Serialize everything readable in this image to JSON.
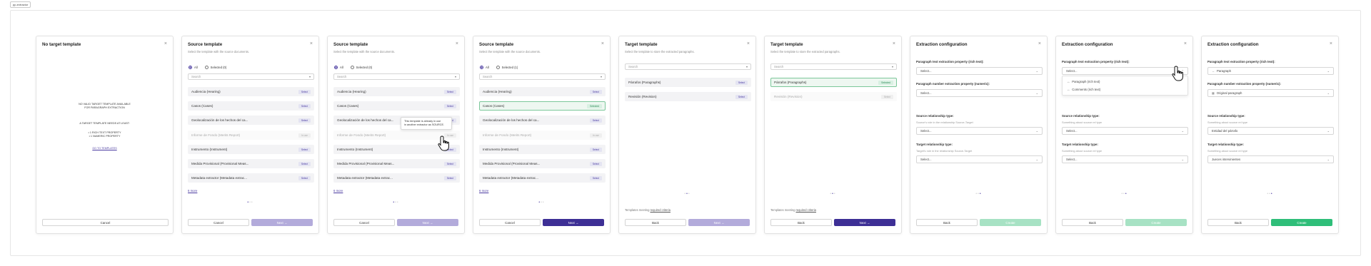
{
  "frame_label": "pp-extractor",
  "colors": {
    "primary": "#3d2f95",
    "primary_disabled": "#b3abdb",
    "success": "#2fbe79",
    "success_disabled": "#a7e2c4",
    "selected_border": "#7cc79a"
  },
  "panel1": {
    "title": "No target template",
    "message_line1": "NO VALID TARGET TEMPLATE AVAILABLE",
    "message_line2": "FOR PARAGRAPH EXTRACTION",
    "requirement_intro": "A TARGET TEMPLATE NEEDS AT LEAST:",
    "requirement_1": "• 1 RICH TEXT PROPERTY",
    "requirement_2": "• 1 NUMERIC PROPERTY",
    "link": "GO TO TEMPLATES",
    "cancel": "Cancel"
  },
  "source": {
    "title": "Source template",
    "subtitle": "Select the template with the source documents.",
    "radio_all": "All",
    "search_placeholder": "Search",
    "select_label": "Select",
    "selected_label": "Selected",
    "ghost_label": "In use",
    "items": [
      "Audiencia (Hearing)",
      "Casos (Cases)",
      "Geolocalización de los hechos del ca...",
      "Informe de Fondo (Merits Report)",
      "Instrumento (Instrument)",
      "Medida Provisional (Provisional Meas...",
      "Metadata extractor (Metadata extrac..."
    ],
    "more": "6 more",
    "cancel": "Cancel",
    "next": "Next",
    "tooltip_line1": "This template is already in use",
    "tooltip_line2": "in another extractor as SOURCE."
  },
  "panel2": {
    "selected_radio": "Selected (0)"
  },
  "panel3": {
    "selected_radio": "Selected (0)"
  },
  "panel4": {
    "selected_radio": "Selected (1)"
  },
  "target": {
    "title": "Target template",
    "subtitle": "Select the template to store the extracted paragraphs.",
    "search_placeholder": "Search",
    "items": [
      "Párrafos (Paragraphs)",
      "Revisión (Revision)"
    ],
    "select_label": "Select",
    "selected_label": "Selected",
    "note_prefix": "Templates meeting",
    "note_link": "required criteria",
    "back": "Back",
    "next": "Next"
  },
  "config": {
    "title": "Extraction configuration",
    "text_prop_label": "Paragraph text extraction property (rich text):",
    "number_prop_label": "Paragraph number extraction property (numeric):",
    "source_rel_label": "Source relationship type:",
    "target_rel_label": "Target relationship type:",
    "placeholder": "Select...",
    "back": "Back",
    "create": "Create"
  },
  "panel7": {
    "source_help": "Source's role in the relationship Source-Target",
    "target_help": "Target's role in the relationship Source-Target"
  },
  "panel8": {
    "source_help": "Something about source rel type",
    "target_help": "Something about source rel type",
    "option_1": "Paragraph (rich text)",
    "option_2": "Comments (rich text)"
  },
  "panel9": {
    "source_help": "Something about source rel type",
    "target_help": "Something about source rel type",
    "text_value": "Paragraph",
    "number_value": "Original paragraph",
    "source_value": "Entidad del párrafo",
    "target_value": "Jueces intervinientes"
  }
}
